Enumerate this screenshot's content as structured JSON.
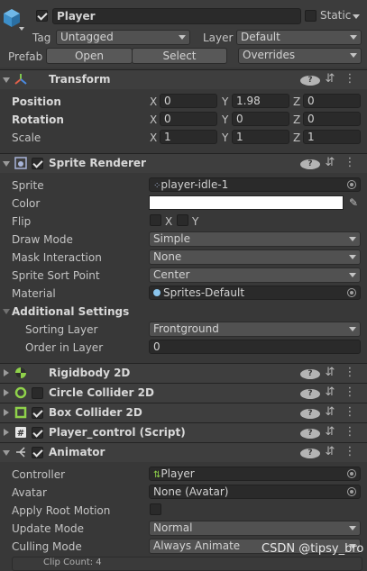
{
  "object": {
    "name": "Player",
    "static_label": "Static",
    "tag_label": "Tag",
    "tag_value": "Untagged",
    "layer_label": "Layer",
    "layer_value": "Default",
    "prefab_label": "Prefab",
    "open_label": "Open",
    "select_label": "Select",
    "overrides_label": "Overrides"
  },
  "transform": {
    "title": "Transform",
    "rows": [
      {
        "label": "Position",
        "x": "0",
        "y": "1.98",
        "z": "0"
      },
      {
        "label": "Rotation",
        "x": "0",
        "y": "0",
        "z": "0"
      },
      {
        "label": "Scale",
        "x": "1",
        "y": "1",
        "z": "1"
      }
    ],
    "axis_x": "X",
    "axis_y": "Y",
    "axis_z": "Z"
  },
  "sprite_renderer": {
    "title": "Sprite Renderer",
    "sprite_label": "Sprite",
    "sprite_value": "player-idle-1",
    "color_label": "Color",
    "flip_label": "Flip",
    "flip_x": "X",
    "flip_y": "Y",
    "draw_mode_label": "Draw Mode",
    "draw_mode_value": "Simple",
    "mask_label": "Mask Interaction",
    "mask_value": "None",
    "sort_point_label": "Sprite Sort Point",
    "sort_point_value": "Center",
    "material_label": "Material",
    "material_value": "Sprites-Default",
    "additional_label": "Additional Settings",
    "sorting_layer_label": "Sorting Layer",
    "sorting_layer_value": "Frontground",
    "order_label": "Order in Layer",
    "order_value": "0"
  },
  "components": [
    {
      "title": "Rigidbody 2D"
    },
    {
      "title": "Circle Collider 2D"
    },
    {
      "title": "Box Collider 2D"
    },
    {
      "title": "Player_control (Script)"
    },
    {
      "title": "Animator"
    }
  ],
  "animator": {
    "controller_label": "Controller",
    "controller_value": "Player",
    "avatar_label": "Avatar",
    "avatar_value": "None (Avatar)",
    "root_motion_label": "Apply Root Motion",
    "update_mode_label": "Update Mode",
    "update_mode_value": "Normal",
    "culling_label": "Culling Mode",
    "culling_value": "Always Animate",
    "clip_count": "Clip Count: 4"
  },
  "watermark": "CSDN @tipsy_bro",
  "colors": {
    "background": "#383838",
    "header": "#3e3e3e",
    "field": "#2a2a2a",
    "white_swatch": "#ffffff"
  }
}
